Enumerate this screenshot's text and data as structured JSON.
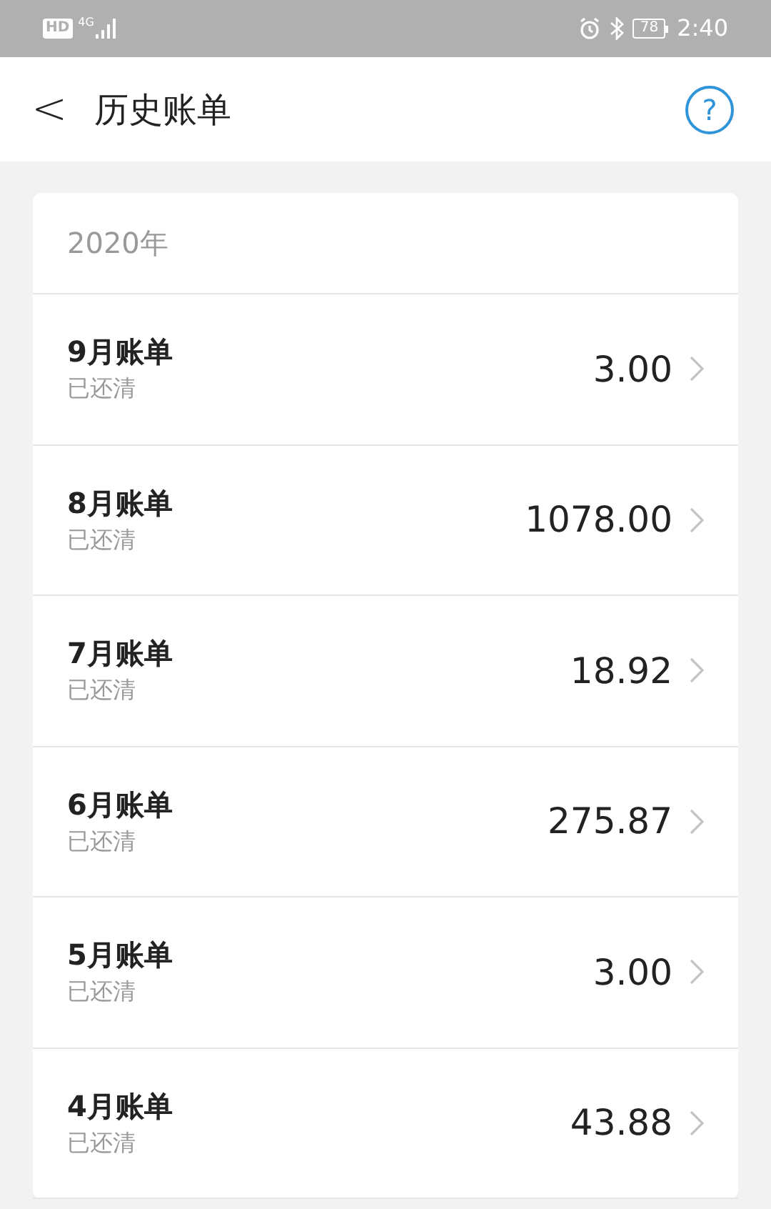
{
  "status_bar": {
    "network_badge": "HD",
    "network_type": "4G",
    "battery": "78",
    "time": "2:40"
  },
  "header": {
    "back": "<",
    "title": "历史账单",
    "help": "?"
  },
  "year": "2020年",
  "bills": [
    {
      "title": "9月账单",
      "status": "已还清",
      "amount": "3.00"
    },
    {
      "title": "8月账单",
      "status": "已还清",
      "amount": "1078.00"
    },
    {
      "title": "7月账单",
      "status": "已还清",
      "amount": "18.92"
    },
    {
      "title": "6月账单",
      "status": "已还清",
      "amount": "275.87"
    },
    {
      "title": "5月账单",
      "status": "已还清",
      "amount": "3.00"
    },
    {
      "title": "4月账单",
      "status": "已还清",
      "amount": "43.88"
    }
  ]
}
